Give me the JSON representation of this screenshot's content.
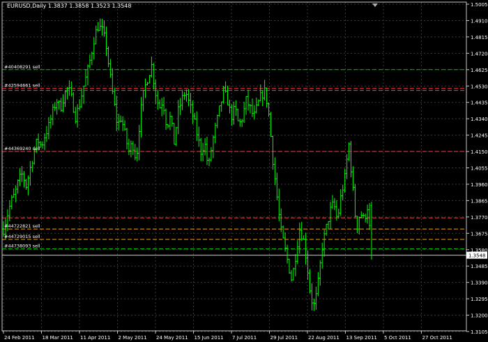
{
  "window": {
    "header_text": "EURUSD,Daily  1.3837 1.3858 1.3523 1.3548"
  },
  "colors": {
    "background": "#000000",
    "bar": "#00ff00",
    "grid": "#3a3a3a",
    "axis": "#c8c8c8",
    "text": "#ffffff",
    "level_red": "#ff3b3b",
    "level_green": "#00c000",
    "level_orange": "#ffa000",
    "price_line": "#c8c8c8"
  },
  "chart_data": {
    "type": "ohlc",
    "symbol": "EURUSD",
    "timeframe": "Daily",
    "title": "EURUSD,Daily",
    "last_ohlc": {
      "open": 1.3837,
      "high": 1.3858,
      "low": 1.3523,
      "close": 1.3548
    },
    "current_price_label": "1.3548",
    "ylim": [
      1.3105,
      1.5005
    ],
    "y_ticks": [
      "1.5005",
      "1.4910",
      "1.4815",
      "1.4720",
      "1.4625",
      "1.4530",
      "1.4435",
      "1.4340",
      "1.4245",
      "1.4150",
      "1.4055",
      "1.3960",
      "1.3865",
      "1.3770",
      "1.3675",
      "1.3580",
      "1.3485",
      "1.3390",
      "1.3295",
      "1.3200",
      "1.3105"
    ],
    "x_ticks": [
      "24 Feb 2011",
      "18 Mar 2011",
      "11 Apr 2011",
      "2 May 2011",
      "24 May 2011",
      "15 Jun 2011",
      "7 Jul 2011",
      "29 Jul 2011",
      "22 Aug 2011",
      "13 Sep 2011",
      "5 Oct 2011",
      "27 Oct 2011"
    ],
    "grid": true,
    "levels": [
      {
        "label": "#40408291 sell",
        "price": 1.4625,
        "color": "green"
      },
      {
        "label": "#42594661 sell",
        "price": 1.4516,
        "color": "red"
      },
      {
        "label": "",
        "price": 1.4504,
        "color": "red"
      },
      {
        "label": "#44369240 sell",
        "price": 1.415,
        "color": "red"
      },
      {
        "label": "",
        "price": 1.3765,
        "color": "red"
      },
      {
        "label": "#44722821 sell",
        "price": 1.37,
        "color": "orange"
      },
      {
        "label": "#44729015 sell",
        "price": 1.364,
        "color": "orange"
      },
      {
        "label": "#44738093 sell",
        "price": 1.3585,
        "color": "green"
      }
    ],
    "close_path": [
      1.37,
      1.378,
      1.386,
      1.39,
      1.398,
      1.402,
      1.395,
      1.405,
      1.415,
      1.422,
      1.418,
      1.425,
      1.43,
      1.438,
      1.445,
      1.44,
      1.448,
      1.452,
      1.445,
      1.435,
      1.442,
      1.452,
      1.46,
      1.47,
      1.482,
      1.488,
      1.485,
      1.478,
      1.46,
      1.445,
      1.43,
      1.435,
      1.425,
      1.415,
      1.42,
      1.41,
      1.435,
      1.45,
      1.458,
      1.465,
      1.45,
      1.44,
      1.445,
      1.43,
      1.435,
      1.42,
      1.438,
      1.445,
      1.45,
      1.442,
      1.435,
      1.425,
      1.415,
      1.42,
      1.405,
      1.42,
      1.43,
      1.44,
      1.45,
      1.445,
      1.435,
      1.44,
      1.43,
      1.435,
      1.445,
      1.44,
      1.435,
      1.442,
      1.448,
      1.45,
      1.435,
      1.41,
      1.39,
      1.37,
      1.36,
      1.35,
      1.34,
      1.355,
      1.37,
      1.365,
      1.35,
      1.33,
      1.325,
      1.34,
      1.36,
      1.37,
      1.38,
      1.385,
      1.375,
      1.39,
      1.4,
      1.42,
      1.395,
      1.37,
      1.38,
      1.375,
      1.3837,
      1.3548
    ]
  }
}
